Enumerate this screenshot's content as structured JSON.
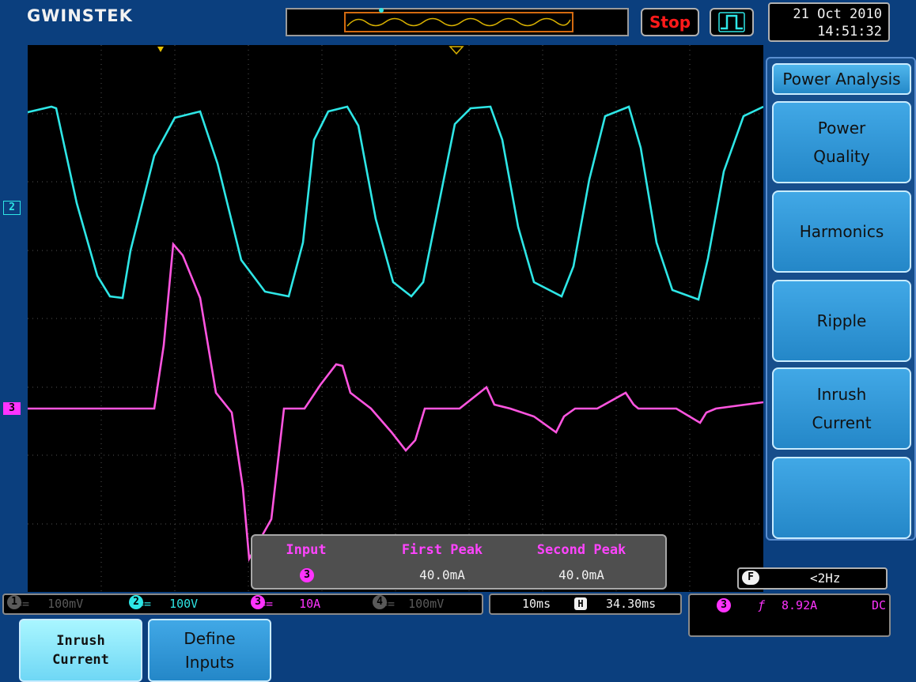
{
  "brand": "GWINSTEK",
  "header": {
    "run_state": "Stop",
    "date": "21 Oct 2010",
    "time": "14:51:32"
  },
  "channels": {
    "ch2_marker": "2",
    "ch3_marker": "3"
  },
  "side_menu": {
    "title": "Power Analysis",
    "items": [
      {
        "label": "Power\nQuality"
      },
      {
        "label": "Harmonics"
      },
      {
        "label": "Ripple"
      },
      {
        "label": "Inrush\nCurrent"
      },
      {
        "label": ""
      }
    ]
  },
  "inrush": {
    "input_label": "Input",
    "input_channel": "3",
    "first_peak_label": "First Peak",
    "first_peak_value": "40.0mA",
    "second_peak_label": "Second Peak",
    "second_peak_value": "40.0mA"
  },
  "filter": {
    "badge": "F",
    "value": "<2Hz"
  },
  "status": {
    "ch1": {
      "num": "1",
      "coupling": "==",
      "scale": "100mV",
      "color": "#5a5a5a"
    },
    "ch2": {
      "num": "2",
      "coupling": "==",
      "scale": "100V",
      "color": "#2ee6e6"
    },
    "ch3": {
      "num": "3",
      "coupling": "==",
      "scale": "10A",
      "color": "#ff33ff"
    },
    "ch4": {
      "num": "4",
      "coupling": "==",
      "scale": "100mV",
      "color": "#5a5a5a"
    },
    "timebase": "10ms",
    "horiz_badge": "H",
    "horiz_position": "34.30ms",
    "trigger_source": "3",
    "trigger_slope": "ƒ",
    "trigger_level": "8.92A",
    "trigger_coupling": "DC"
  },
  "soft_keys": {
    "inrush": "Inrush\nCurrent",
    "define": "Define\nInputs"
  },
  "colors": {
    "ch2": "#2ee6e6",
    "ch3": "#ff33ff",
    "background": "#0b3f7e"
  }
}
